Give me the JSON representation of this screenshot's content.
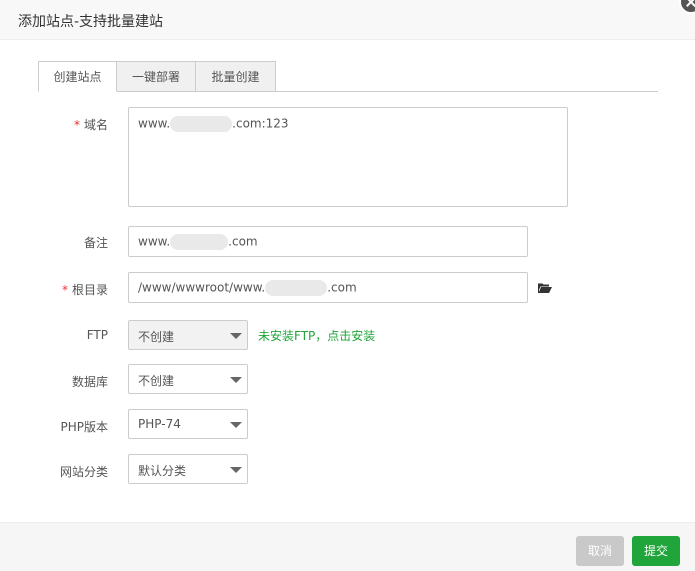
{
  "dialog": {
    "title": "添加站点-支持批量建站"
  },
  "tabs": [
    {
      "label": "创建站点",
      "active": true
    },
    {
      "label": "一键部署",
      "active": false
    },
    {
      "label": "批量创建",
      "active": false
    }
  ],
  "form": {
    "domain": {
      "label": "域名",
      "required_mark": "*",
      "value_prefix": "www.",
      "value_suffix": ".com:123"
    },
    "remark": {
      "label": "备注",
      "value_prefix": "www.",
      "value_suffix": ".com"
    },
    "root": {
      "label": "根目录",
      "required_mark": "*",
      "value_prefix": "/www/wwwroot/www.",
      "value_suffix": ".com",
      "folder_icon": "folder-open-icon"
    },
    "ftp": {
      "label": "FTP",
      "selected": "不创建",
      "note": "未安装FTP，点击安装",
      "disabled": true
    },
    "database": {
      "label": "数据库",
      "selected": "不创建"
    },
    "php": {
      "label": "PHP版本",
      "selected": "PHP-74"
    },
    "category": {
      "label": "网站分类",
      "selected": "默认分类"
    }
  },
  "footer": {
    "cancel_label": "取消",
    "submit_label": "提交"
  },
  "colors": {
    "accent_green": "#20a53a",
    "required_red": "#e33333",
    "cancel_gray": "#c9c9c9"
  }
}
